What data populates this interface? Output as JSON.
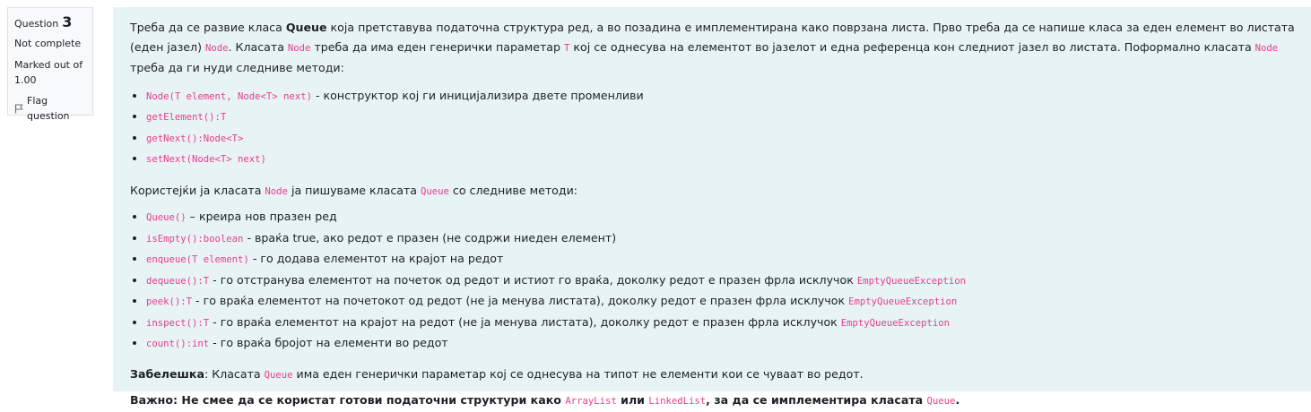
{
  "info": {
    "question_label": "Question",
    "question_number": "3",
    "state": "Not complete",
    "grade_line1": "Marked out of",
    "grade_line2": "1.00",
    "flag_label": "Flag question"
  },
  "p1": {
    "t1": "Треба да се развие класа ",
    "queue_bold": "Queue",
    "t2": " која претставува податочна структура ред, а во позадина е имплементирана како поврзана листа. Прво треба да се напише класа за еден елемент во листата (еден јазел) ",
    "c1": "Node",
    "t3": ". Класата ",
    "c2": "Node",
    "t4": " треба да има еден генерички параметар ",
    "c3": "T",
    "t5": " кој се однесува на елементот во јазелот и една референца кон следниот јазел во листата. Поформално класата ",
    "c4": "Node",
    "t6": " треба да ги нуди следниве методи:"
  },
  "node_methods": [
    {
      "code": "Node(T element, Node<T> next)",
      "desc": " - конструктор кој ги иницијализира двете променливи"
    },
    {
      "code": "getElement():T",
      "desc": ""
    },
    {
      "code": "getNext():Node<T>",
      "desc": ""
    },
    {
      "code": "setNext(Node<T> next)",
      "desc": ""
    }
  ],
  "p2": {
    "t1": "Користејќи ја класата ",
    "c1": "Node",
    "t2": " ја пишуваме класата ",
    "c2": "Queue",
    "t3": " со следниве методи:"
  },
  "queue_methods": [
    {
      "code": "Queue()",
      "desc": " – креира нов празен ред",
      "exc": ""
    },
    {
      "code": "isEmpty():boolean",
      "desc": " - враќа true, ако редот е празен (не содржи ниеден елемент)",
      "exc": ""
    },
    {
      "code": "enqueue(T element)",
      "desc": " - го додава елементот на крајот на редот",
      "exc": ""
    },
    {
      "code": "dequeue():T",
      "desc": " - го отстранува елементот на почеток од редот и истиот го враќа, доколку редот е празен фрла исклучок ",
      "exc": "EmptyQueueException"
    },
    {
      "code": "peek():T",
      "desc": " - го враќа елементот на почетокот од редот (не ја менува листата), доколку редот е празен фрла исклучок ",
      "exc": "EmptyQueueException"
    },
    {
      "code": "inspect():T",
      "desc": " - го враќа елементот на крајот на редот (не ја менува листата), доколку редот е празен фрла исклучок ",
      "exc": "EmptyQueueException"
    },
    {
      "code": "count():int",
      "desc": " - го враќа бројот на елементи во редот",
      "exc": ""
    }
  ],
  "note": {
    "label": "Забелешка",
    "t1": ": Класата ",
    "c1": "Queue",
    "t2": " има еден генерички параметар кој се однесува на типот не елементи кои се чуваат во редот."
  },
  "important": {
    "t1": "Важно: Не смее да се користат готови податочни структури како ",
    "c1": "ArrayList",
    "t2": " или ",
    "c2": "LinkedList",
    "t3": ", за да се имплементира класата ",
    "c3": "Queue",
    "t4": "."
  }
}
